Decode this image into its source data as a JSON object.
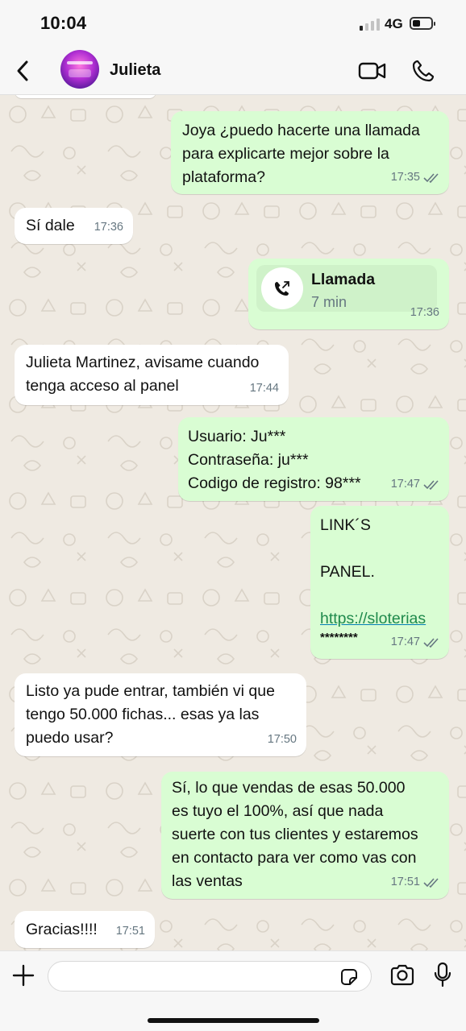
{
  "status_bar": {
    "time": "10:04",
    "network": "4G",
    "signal_bars_on": 1,
    "signal_bars_total": 4,
    "battery_level": 0.45
  },
  "header": {
    "contact_name": "Julieta",
    "avatar_icon": "avatar-image"
  },
  "messages": [
    {
      "direction": "out",
      "text": "Joya ¿puedo hacerte una llamada\npara explicarte mejor sobre la\nplataforma?",
      "time": "17:35",
      "status": "read"
    },
    {
      "direction": "in",
      "text": "Sí dale",
      "time": "17:36"
    },
    {
      "direction": "out",
      "type": "call",
      "call_title": "Llamada",
      "call_duration": "7 min",
      "time": "17:36"
    },
    {
      "direction": "in",
      "text": "Julieta Martinez, avisame cuando\ntenga acceso al panel",
      "time": "17:44"
    },
    {
      "direction": "out",
      "text": "Usuario: Ju***\nContraseña: ju***\nCodigo de registro: 98***",
      "time": "17:47",
      "status": "read"
    },
    {
      "direction": "out",
      "line1": "LINK´S",
      "line2": "PANEL.",
      "link_text": "https://sloterias",
      "masked": "********",
      "time": "17:47",
      "status": "read"
    },
    {
      "direction": "in",
      "text": "Listo ya pude entrar, también vi que\ntengo 50.000 fichas... esas ya las\npuedo usar?",
      "time": "17:50"
    },
    {
      "direction": "out",
      "text": "Sí, lo que vendas de esas 50.000\nes tuyo el 100%, así que nada\nsuerte con tus clientes y estaremos\nen contacto para ver como vas con\nlas ventas",
      "time": "17:51",
      "status": "read"
    },
    {
      "direction": "in",
      "text": "Gracias!!!!",
      "time": "17:51"
    }
  ],
  "input": {
    "placeholder": ""
  },
  "colors": {
    "incoming": "#ffffff",
    "outgoing": "#d9fdd3",
    "background": "#efeae2",
    "read_ticks": "#667781",
    "link": "#1f8a4c"
  }
}
